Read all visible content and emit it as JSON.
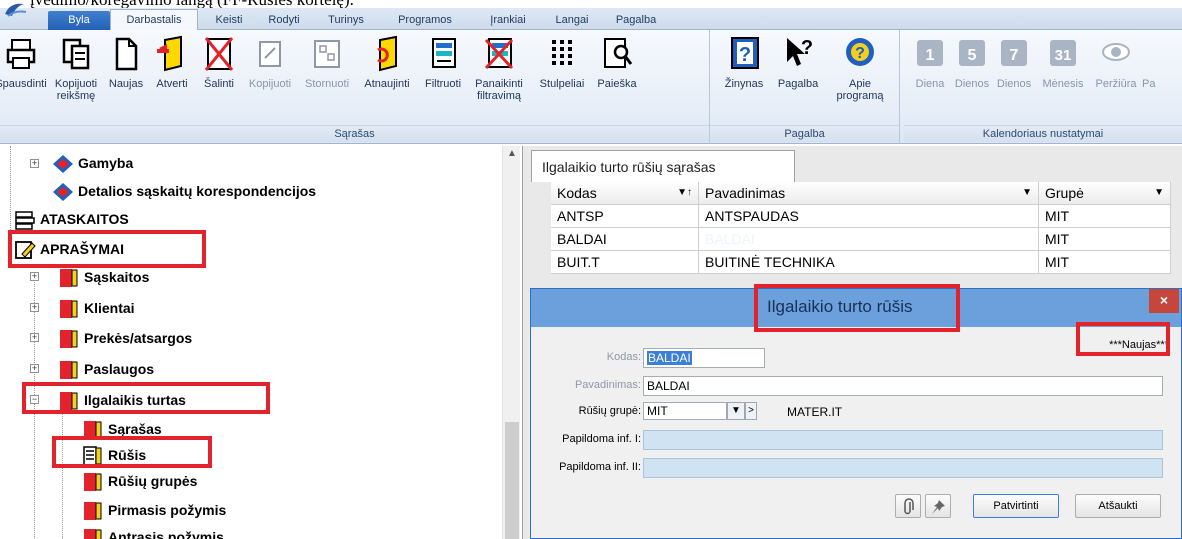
{
  "caption": "įvedimo/koregavimo langą (FF-Rūšies kortelę).",
  "menubar": {
    "tabs": [
      {
        "label": "Byla"
      },
      {
        "label": "Darbastalis"
      },
      {
        "label": "Keisti"
      },
      {
        "label": "Rodyti"
      },
      {
        "label": "Turinys"
      },
      {
        "label": "Programos"
      },
      {
        "label": "Įrankiai"
      },
      {
        "label": "Langai"
      },
      {
        "label": "Pagalba"
      }
    ]
  },
  "ribbon": {
    "groups": [
      {
        "title": "Sąrašas",
        "buttons": [
          {
            "label": "Spausdinti",
            "label2": ""
          },
          {
            "label": "Kopijuoti",
            "label2": "reikšmę"
          },
          {
            "label": "Naujas",
            "label2": ""
          },
          {
            "label": "Atverti",
            "label2": ""
          },
          {
            "label": "Šalinti",
            "label2": ""
          },
          {
            "label": "Kopijuoti",
            "label2": ""
          },
          {
            "label": "Stornuoti",
            "label2": ""
          },
          {
            "label": "Atnaujinti",
            "label2": ""
          },
          {
            "label": "Filtruoti",
            "label2": ""
          },
          {
            "label": "Panaikinti",
            "label2": "filtravimą"
          },
          {
            "label": "Stulpeliai",
            "label2": ""
          },
          {
            "label": "Paieška",
            "label2": ""
          }
        ]
      },
      {
        "title": "Pagalba",
        "buttons": [
          {
            "label": "Žinynas",
            "label2": ""
          },
          {
            "label": "Pagalba",
            "label2": ""
          },
          {
            "label": "Apie",
            "label2": "programą"
          }
        ]
      },
      {
        "title": "Kalendoriaus nustatymai",
        "buttons": [
          {
            "label": "Diena",
            "icon_text": "1"
          },
          {
            "label": "Dienos",
            "icon_text": "5"
          },
          {
            "label": "Dienos",
            "icon_text": "7"
          },
          {
            "label": "Mėnesis",
            "icon_text": "31"
          },
          {
            "label": "Peržiūra",
            "icon_text": ""
          },
          {
            "label": "Pa",
            "icon_text": ""
          }
        ]
      }
    ]
  },
  "tree": {
    "nodes": [
      {
        "label": "Gamyba"
      },
      {
        "label": "Detalios sąskaitų korespondencijos"
      },
      {
        "label": "ATASKAITOS"
      },
      {
        "label": "APRAŠYMAI"
      },
      {
        "label": "Sąskaitos"
      },
      {
        "label": "Klientai"
      },
      {
        "label": "Prekės/atsargos"
      },
      {
        "label": "Paslaugos"
      },
      {
        "label": "Ilgalaikis turtas"
      },
      {
        "label": "Sąrašas"
      },
      {
        "label": "Rūšis"
      },
      {
        "label": "Rūšių grupės"
      },
      {
        "label": "Pirmasis požymis"
      },
      {
        "label": "Antrasis požymis"
      }
    ]
  },
  "list": {
    "tab_title": "Ilgalaikio turto rūšių sąrašas",
    "columns": [
      "Kodas",
      "Pavadinimas",
      "Grupė"
    ],
    "rows": [
      [
        "ANTSP",
        "ANTSPAUDAS",
        "MIT"
      ],
      [
        "BALDAI",
        "BALDAI",
        "MIT"
      ],
      [
        "BUIT.T",
        "BUITINĖ TECHNIKA",
        "MIT"
      ]
    ]
  },
  "dialog": {
    "title": "Ilgalaikio turto rūšis",
    "close": "×",
    "status": "***Naujas***",
    "fields": {
      "kodas_label": "Kodas:",
      "kodas_value": "BALDAI",
      "pavadinimas_label": "Pavadinimas:",
      "pavadinimas_value": "BALDAI",
      "grupe_label": "Rūšių grupė:",
      "grupe_value": "MIT",
      "grupe_name": "MATER.IT",
      "inf1_label": "Papildoma inf. I:",
      "inf1_value": "",
      "inf2_label": "Papildoma inf. II:",
      "inf2_value": ""
    },
    "dropdown_btn": "▼",
    "next_btn": ">",
    "confirm": "Patvirtinti",
    "cancel": "Atšaukti"
  },
  "colors": {
    "highlight": "#e2232b",
    "dialog_title": "#6ca0dc",
    "close": "#c7463b"
  }
}
